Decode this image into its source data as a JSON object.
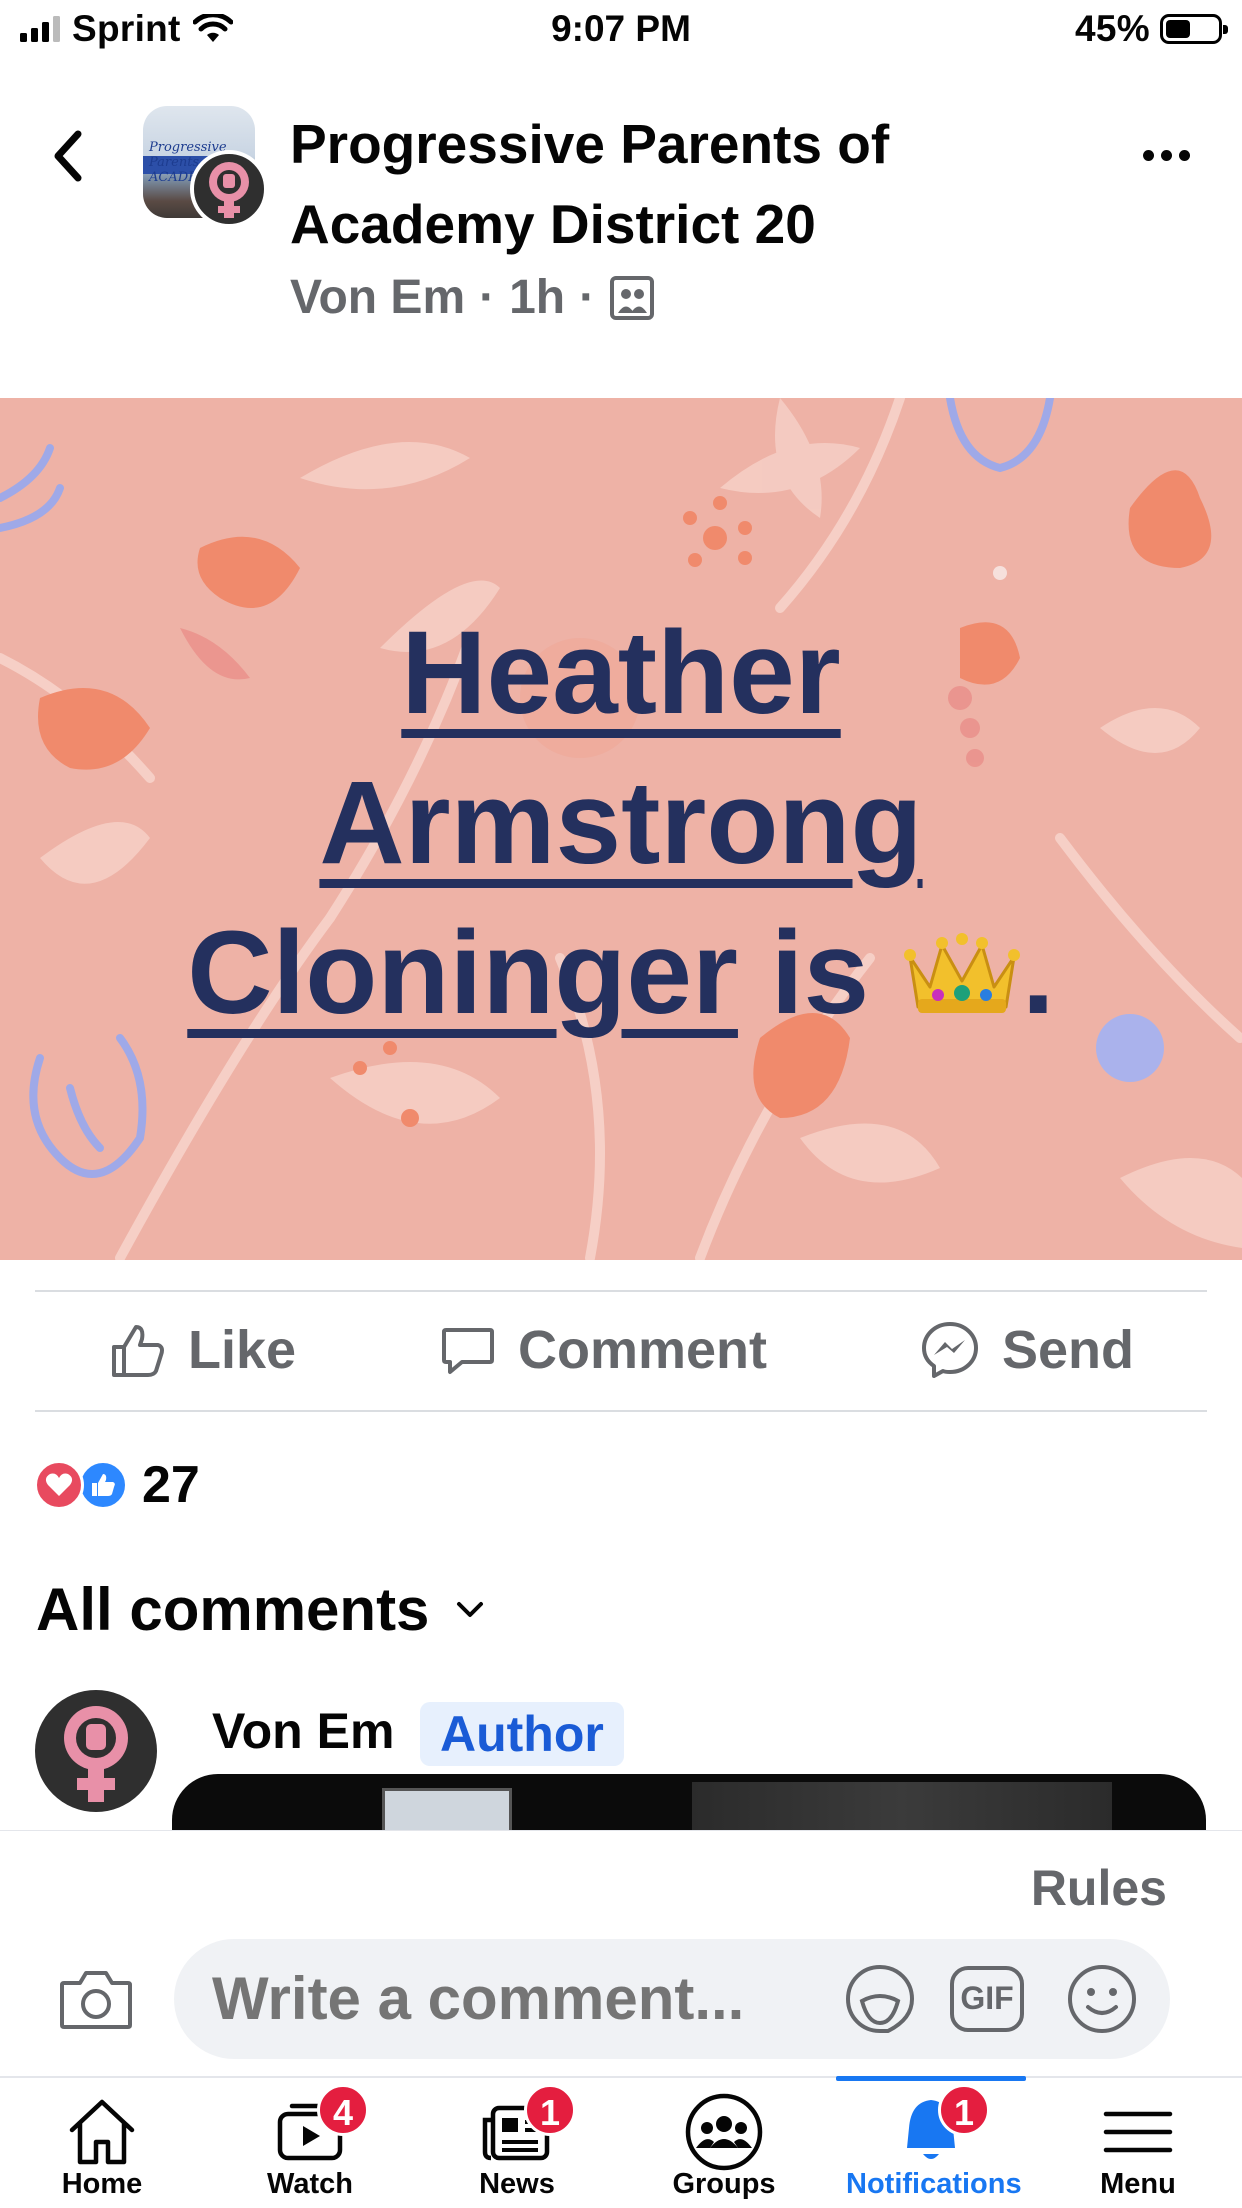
{
  "status_bar": {
    "carrier": "Sprint",
    "time": "9:07 PM",
    "battery": "45%",
    "battery_level": 0.45
  },
  "post": {
    "group_name": "Progressive Parents of Academy District 20",
    "group_avatar_text": "Progressive Parents of ACADEMY",
    "author": "Von Em",
    "time_ago": "1h",
    "separator": "·",
    "audience_icon": "group-members-icon",
    "background_color": "#eeb2a6",
    "text_color": "#24305e",
    "text": {
      "line1": "Heather",
      "line2": "Armstrong",
      "line3_name": "Cloninger",
      "line3_suffix": " is ",
      "emoji": "crown",
      "end": "."
    }
  },
  "actions": {
    "like": "Like",
    "comment": "Comment",
    "send": "Send"
  },
  "reactions": {
    "types": [
      "love",
      "like"
    ],
    "count": "27"
  },
  "comments": {
    "heading": "All comments",
    "first": {
      "name": "Von Em",
      "badge": "Author"
    }
  },
  "composer": {
    "rules": "Rules",
    "placeholder": "Write a comment...",
    "gif": "GIF"
  },
  "tabbar": {
    "tabs": [
      {
        "label": "Home",
        "icon": "home-icon",
        "badge": null
      },
      {
        "label": "Watch",
        "icon": "watch-icon",
        "badge": "4"
      },
      {
        "label": "News",
        "icon": "news-icon",
        "badge": "1"
      },
      {
        "label": "Groups",
        "icon": "groups-icon",
        "badge": null
      },
      {
        "label": "Notifications",
        "icon": "bell-icon",
        "badge": "1"
      },
      {
        "label": "Menu",
        "icon": "menu-icon",
        "badge": null
      }
    ],
    "active": "Notifications",
    "active_color": "#1877f2",
    "badge_color": "#e41e3f"
  }
}
